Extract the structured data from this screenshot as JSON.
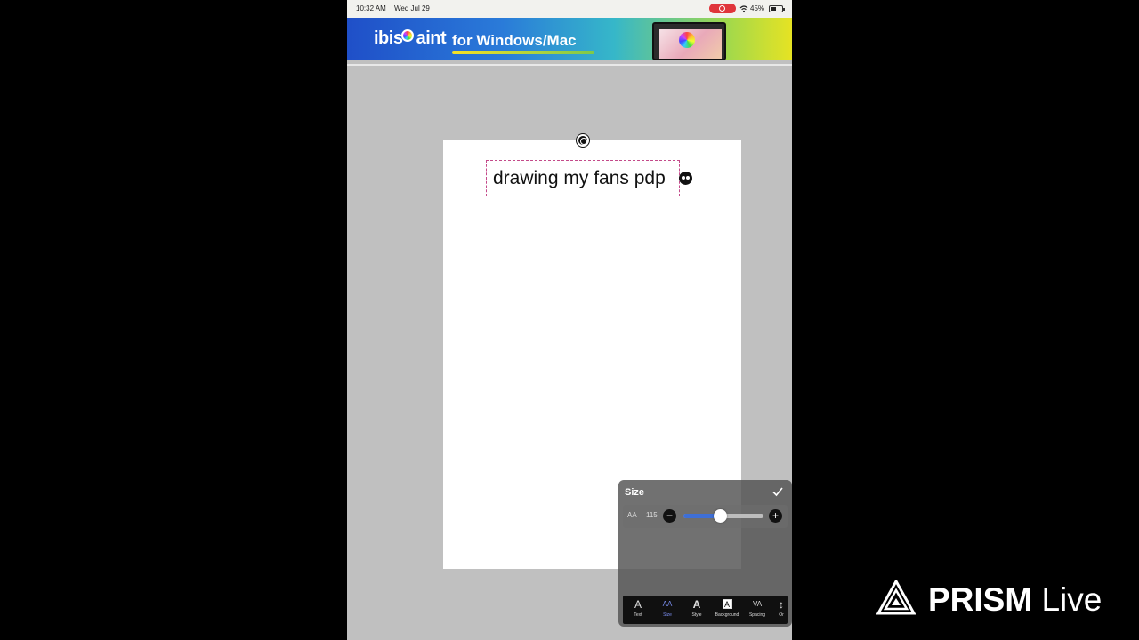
{
  "status_bar": {
    "time": "10:32 AM",
    "date": "Wed Jul 29",
    "battery": "45%",
    "recording_color": "#e0353b"
  },
  "ad_banner": {
    "logo_prefix": "ibis",
    "logo_suffix": "aint",
    "tagline": "for Windows/Mac"
  },
  "canvas": {
    "text": "drawing my fans pdp",
    "selection_color": "#c44a8a"
  },
  "size_panel": {
    "title": "Size",
    "aa_label": "AA",
    "size_value": "115",
    "slider_fraction": 0.45,
    "slider_color": "#3e6fd6",
    "tabs": [
      {
        "label": "Text",
        "icon": "text-icon"
      },
      {
        "label": "Size",
        "icon": "size-icon"
      },
      {
        "label": "Style",
        "icon": "style-icon"
      },
      {
        "label": "Background",
        "icon": "background-icon"
      },
      {
        "label": "Spacing",
        "icon": "spacing-icon"
      },
      {
        "label": "Or",
        "icon": "orientation-icon"
      }
    ],
    "active_tab": "Size"
  },
  "watermark": {
    "brand": "PRISM",
    "suffix": "Live"
  }
}
